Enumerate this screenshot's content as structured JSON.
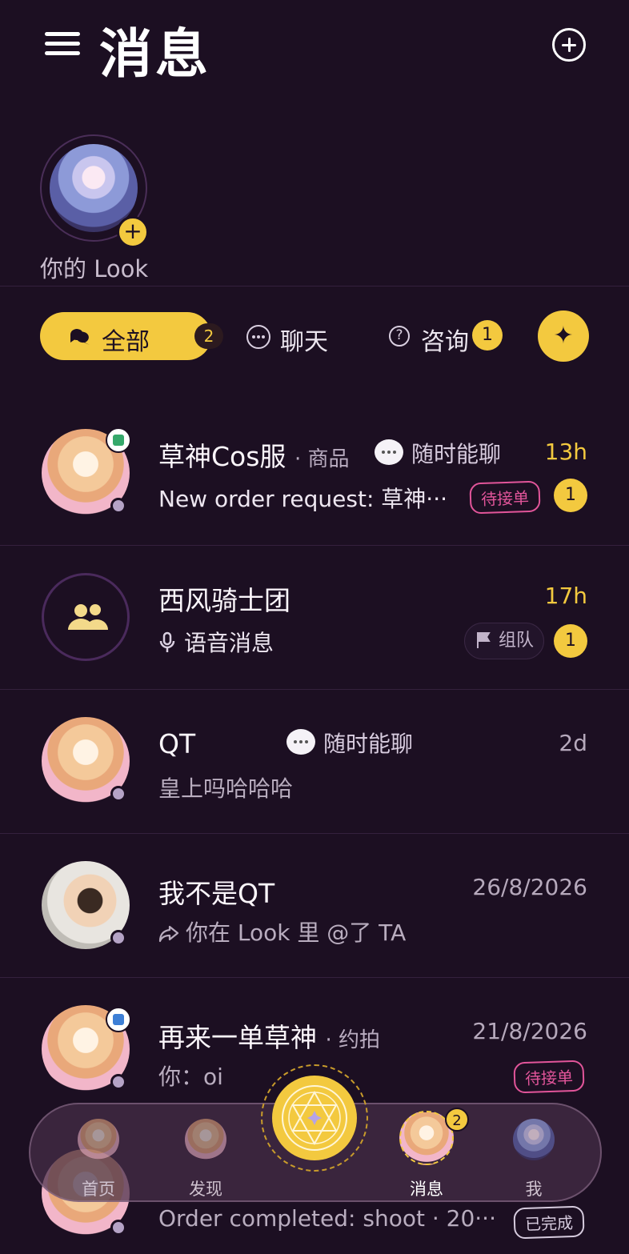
{
  "header": {
    "title": "消息"
  },
  "look": {
    "label": "你的 Look",
    "add_symbol": "+"
  },
  "filters": {
    "all": {
      "label": "全部",
      "count": "2"
    },
    "chat": {
      "label": "聊天"
    },
    "consult": {
      "label": "咨询",
      "count": "1"
    },
    "sparkle_symbol": "✦"
  },
  "conversations": [
    {
      "name": "草神Cos服",
      "subtitle": "· 商品",
      "chat_status": "随时能聊",
      "time": "13h",
      "preview": "New order request: 草神···",
      "tag": "待接单",
      "unread": "1"
    },
    {
      "name": "西风骑士团",
      "time": "17h",
      "preview": "语音消息",
      "team_tag": "组队",
      "unread": "1"
    },
    {
      "name": "QT",
      "chat_status": "随时能聊",
      "time": "2d",
      "preview": "皇上吗哈哈哈"
    },
    {
      "name": "我不是QT",
      "time": "26/8/2026",
      "preview": "你在 Look 里 @了 TA"
    },
    {
      "name": "再来一单草神",
      "subtitle": "· 约拍",
      "time": "21/8/2026",
      "preview": "你：oi",
      "tag": "待接单"
    },
    {
      "preview": "Order completed: shoot · 20···",
      "tag": "已完成"
    }
  ],
  "tabbar": {
    "home": "首页",
    "discover": "发现",
    "messages": "消息",
    "messages_badge": "2",
    "me": "我"
  },
  "colors": {
    "background": "#1c0f22",
    "accent": "#f3c93f",
    "tag_pink": "#e2559a"
  }
}
